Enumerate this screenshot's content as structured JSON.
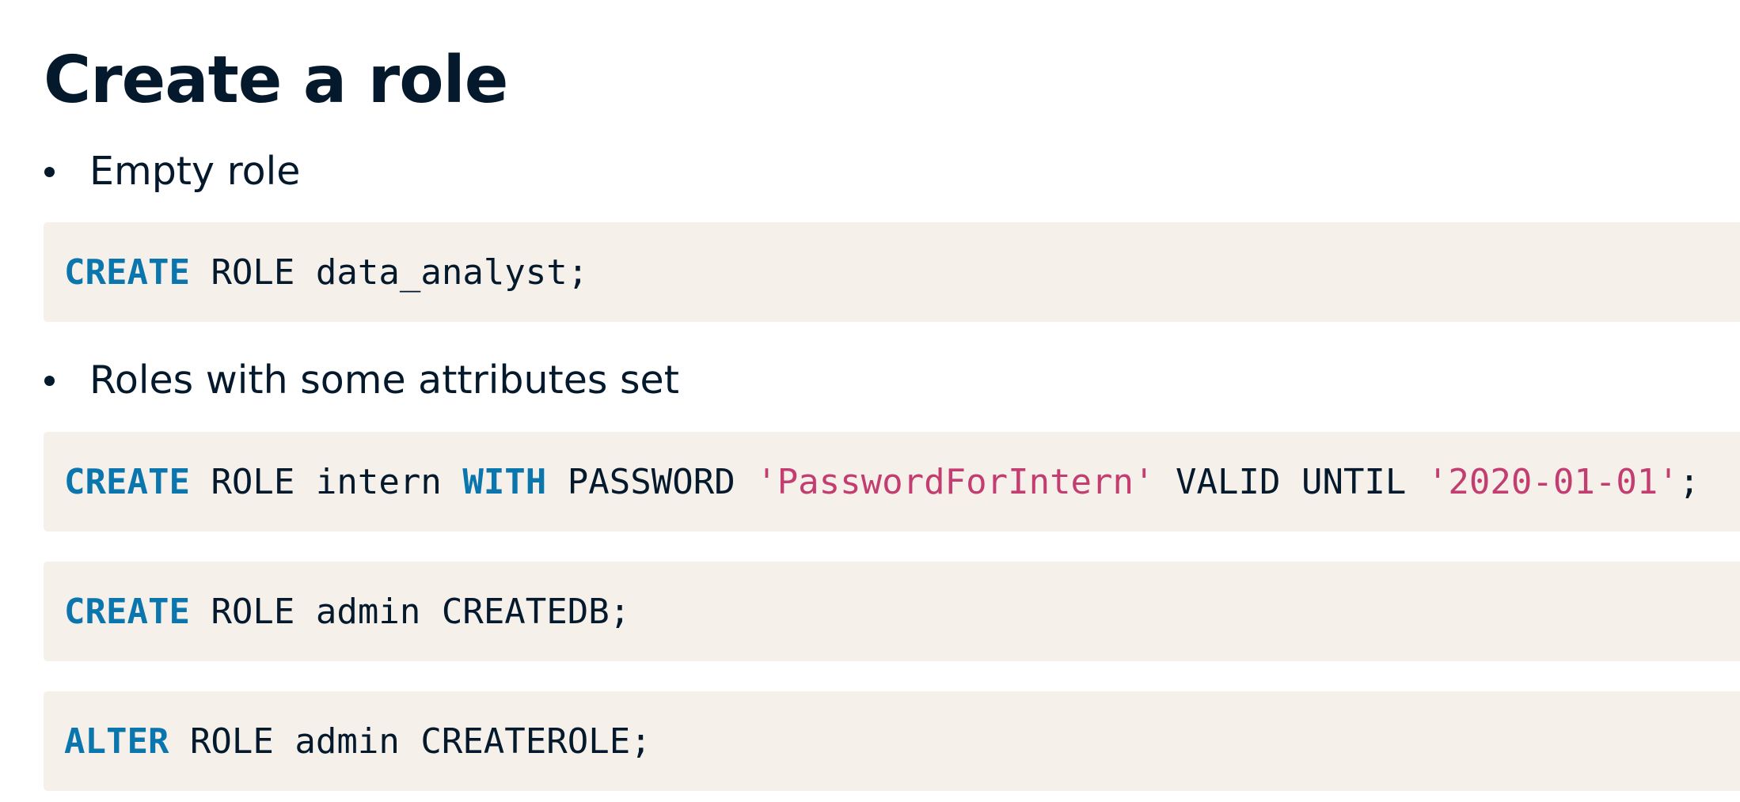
{
  "title": "Create a role",
  "bullets": [
    "Empty role",
    "Roles with some attributes set"
  ],
  "code_blocks": [
    {
      "tokens": [
        {
          "type": "keyword",
          "text": "CREATE"
        },
        {
          "type": "plain",
          "text": " ROLE data_analyst;"
        }
      ]
    },
    {
      "tokens": [
        {
          "type": "keyword",
          "text": "CREATE"
        },
        {
          "type": "plain",
          "text": " ROLE intern "
        },
        {
          "type": "keyword",
          "text": "WITH"
        },
        {
          "type": "plain",
          "text": " PASSWORD "
        },
        {
          "type": "string",
          "text": "'PasswordForIntern'"
        },
        {
          "type": "plain",
          "text": " VALID UNTIL "
        },
        {
          "type": "string",
          "text": "'2020-01-01'"
        },
        {
          "type": "plain",
          "text": ";"
        }
      ]
    },
    {
      "tokens": [
        {
          "type": "keyword",
          "text": "CREATE"
        },
        {
          "type": "plain",
          "text": " ROLE admin CREATEDB;"
        }
      ]
    },
    {
      "tokens": [
        {
          "type": "keyword",
          "text": "ALTER"
        },
        {
          "type": "plain",
          "text": " ROLE admin CREATEROLE;"
        }
      ]
    }
  ],
  "colors": {
    "text": "#05192d",
    "keyword": "#0b75ad",
    "string": "#c33d71",
    "code_background": "#f5f1ea"
  }
}
